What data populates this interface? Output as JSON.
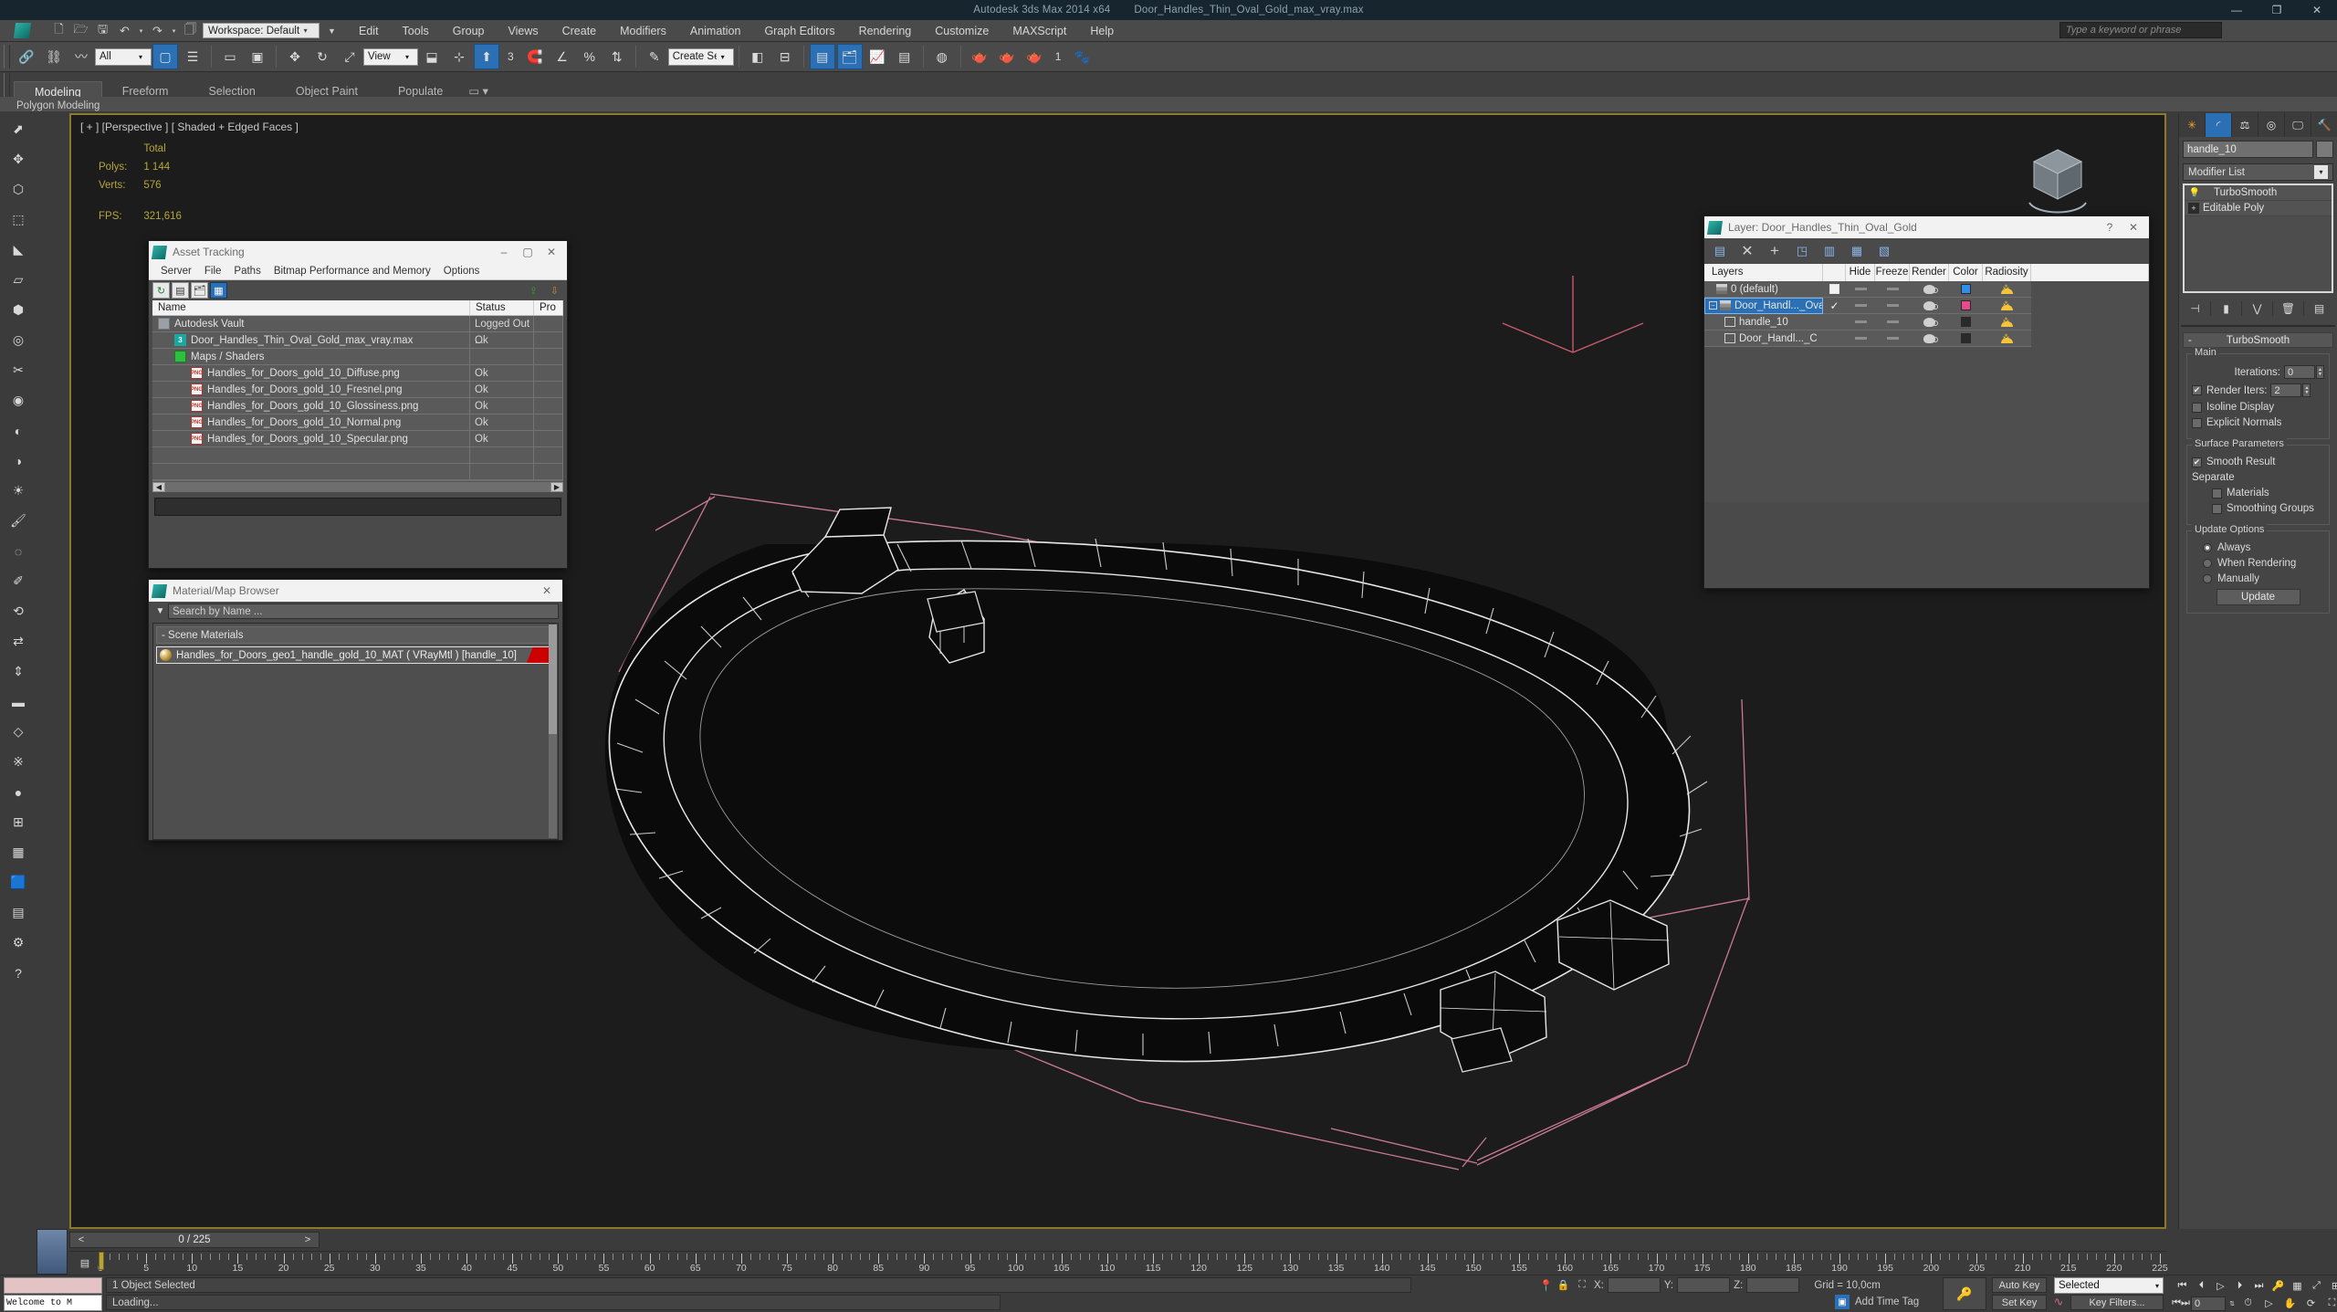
{
  "window": {
    "app_title": "Autodesk 3ds Max  2014 x64",
    "file_title": "Door_Handles_Thin_Oval_Gold_max_vray.max",
    "minimize": "—",
    "maximize": "❐",
    "close": "✕"
  },
  "menu": {
    "workspace_label": "Workspace: Default",
    "items": [
      "Edit",
      "Tools",
      "Group",
      "Views",
      "Create",
      "Modifiers",
      "Animation",
      "Graph Editors",
      "Rendering",
      "Customize",
      "MAXScript",
      "Help"
    ],
    "search_placeholder": "Type a keyword or phrase"
  },
  "toolbar": {
    "filter_combo": "All",
    "reference_combo": "View",
    "selection_set_combo": "Create Selection Se",
    "snap_number": "3",
    "field_number": "1",
    "icons": [
      "link-icon",
      "unlink-icon",
      "bind-spacewarp-icon",
      "select-object-icon",
      "select-by-name-icon",
      "rect-select-icon",
      "window-crossing-icon",
      "select-move-icon",
      "select-rotate-icon",
      "select-scale-icon",
      "use-pivot-icon",
      "use-center-icon",
      "mirror-icon",
      "align-icon",
      "layer-manager-icon",
      "curve-editor-icon",
      "schematic-view-icon",
      "material-editor-icon",
      "render-setup-icon",
      "render-frame-icon",
      "render-production-icon"
    ]
  },
  "ribbon": {
    "tabs": [
      "Modeling",
      "Freeform",
      "Selection",
      "Object Paint",
      "Populate"
    ],
    "active_tab": "Modeling",
    "panel_label": "Polygon Modeling"
  },
  "viewport": {
    "label": "[ + ] [Perspective ] [ Shaded + Edged Faces ]",
    "stats": {
      "total_header": "Total",
      "polys_label": "Polys:",
      "polys_value": "1 144",
      "verts_label": "Verts:",
      "verts_value": "576",
      "fps_label": "FPS:",
      "fps_value": "321,616"
    }
  },
  "asset_tracking": {
    "title": "Asset Tracking",
    "menu": [
      "Server",
      "File",
      "Paths",
      "Bitmap Performance and Memory",
      "Options"
    ],
    "columns": [
      "Name",
      "Status",
      "Pro"
    ],
    "toolbar_icons": [
      "refresh-icon",
      "list-view-icon",
      "tree-view-icon",
      "grid-view-icon"
    ],
    "rows": [
      {
        "indent": 0,
        "icon": "vault-icon",
        "name": "Autodesk Vault",
        "status": "Logged Out ..."
      },
      {
        "indent": 1,
        "icon": "max-file-icon",
        "name": "Door_Handles_Thin_Oval_Gold_max_vray.max",
        "status": "Ok"
      },
      {
        "indent": 1,
        "icon": "maps-icon",
        "name": "Maps / Shaders",
        "status": ""
      },
      {
        "indent": 2,
        "icon": "png-icon",
        "name": "Handles_for_Doors_gold_10_Diffuse.png",
        "status": "Ok"
      },
      {
        "indent": 2,
        "icon": "png-icon",
        "name": "Handles_for_Doors_gold_10_Fresnel.png",
        "status": "Ok"
      },
      {
        "indent": 2,
        "icon": "png-icon",
        "name": "Handles_for_Doors_gold_10_Glossiness.png",
        "status": "Ok"
      },
      {
        "indent": 2,
        "icon": "png-icon",
        "name": "Handles_for_Doors_gold_10_Normal.png",
        "status": "Ok"
      },
      {
        "indent": 2,
        "icon": "png-icon",
        "name": "Handles_for_Doors_gold_10_Specular.png",
        "status": "Ok"
      },
      {
        "indent": 0,
        "icon": "",
        "name": "",
        "status": ""
      },
      {
        "indent": 0,
        "icon": "",
        "name": "",
        "status": ""
      }
    ]
  },
  "material_browser": {
    "title": "Material/Map Browser",
    "search_placeholder": "Search by Name ...",
    "group_label": "- Scene Materials",
    "material": "Handles_for_Doors_geo1_handle_gold_10_MAT ( VRayMtl ) [handle_10]",
    "material_color": "#cc0000"
  },
  "layer_dialog": {
    "title": "Layer: Door_Handles_Thin_Oval_Gold",
    "help": "?",
    "close": "✕",
    "toolbar_icons": [
      "new-layer-icon",
      "delete-layer-icon",
      "add-layer-icon",
      "select-objects-icon",
      "select-highlight-icon",
      "highlight-selected-icon",
      "hide-unhide-icon"
    ],
    "columns": [
      "Layers",
      "",
      "Hide",
      "Freeze",
      "Render",
      "Color",
      "Radiosity"
    ],
    "rows": [
      {
        "name": "0 (default)",
        "type": "layer",
        "selected": false,
        "current": false,
        "color": "#2f8fe8",
        "indent": 1
      },
      {
        "name": "Door_Handl..._Ova",
        "type": "layer",
        "selected": true,
        "current": true,
        "color": "#e8488c",
        "indent": 0
      },
      {
        "name": "handle_10",
        "type": "object",
        "selected": false,
        "current": false,
        "color": "#2a2a2a",
        "indent": 2
      },
      {
        "name": "Door_Handl..._C",
        "type": "object",
        "selected": false,
        "current": false,
        "color": "#2a2a2a",
        "indent": 2
      }
    ]
  },
  "command_panel": {
    "tabs": [
      "create-tab",
      "modify-tab",
      "hierarchy-tab",
      "motion-tab",
      "display-tab",
      "utilities-tab"
    ],
    "active_tab_index": 1,
    "object_name": "handle_10",
    "modifier_list_label": "Modifier List",
    "stack": [
      {
        "name": "TurboSmooth",
        "icon": "bulb-icon"
      },
      {
        "name": "Editable Poly",
        "icon": "plus-icon"
      }
    ],
    "rollup_title": "TurboSmooth",
    "main_group": "Main",
    "iterations_label": "Iterations:",
    "iterations_value": "0",
    "render_iters_label": "Render Iters:",
    "render_iters_value": "2",
    "render_iters_checked": true,
    "isoline_label": "Isoline Display",
    "explicit_normals_label": "Explicit Normals",
    "surface_group": "Surface Parameters",
    "smooth_result_label": "Smooth Result",
    "smooth_result_checked": true,
    "separate_label": "Separate",
    "materials_label": "Materials",
    "smoothing_groups_label": "Smoothing Groups",
    "update_group": "Update Options",
    "update_options": [
      "Always",
      "When Rendering",
      "Manually"
    ],
    "update_selected": "Always",
    "update_button": "Update"
  },
  "timeline": {
    "frame_display": "0 / 225",
    "prev_frame": "<",
    "next_frame": ">",
    "tick_labels": [
      "0",
      "5",
      "10",
      "15",
      "20",
      "25",
      "30",
      "35",
      "40",
      "45",
      "50",
      "55",
      "60",
      "65",
      "70",
      "75",
      "80",
      "85",
      "90",
      "95",
      "100",
      "105",
      "110",
      "115",
      "120",
      "125",
      "130",
      "135",
      "140",
      "145",
      "150",
      "155",
      "160",
      "165",
      "170",
      "175",
      "180",
      "185",
      "190",
      "195",
      "200",
      "205",
      "210",
      "215",
      "220",
      "225"
    ],
    "current_frame": 0,
    "frame_max": 225
  },
  "statusbar": {
    "maxscript_listener_text": "Welcome to M",
    "selection_status": "1 Object Selected",
    "prompt": "Loading...",
    "coord_x_label": "X:",
    "coord_y_label": "Y:",
    "coord_z_label": "Z:",
    "coord_x_value": "",
    "coord_y_value": "",
    "coord_z_value": "",
    "grid_label": "Grid = 10,0cm",
    "add_time_tag": "Add Time Tag",
    "auto_key": "Auto Key",
    "set_key": "Set Key",
    "key_mode_combo": "Selected",
    "key_filters": "Key Filters...",
    "key_frame_value": "0"
  }
}
